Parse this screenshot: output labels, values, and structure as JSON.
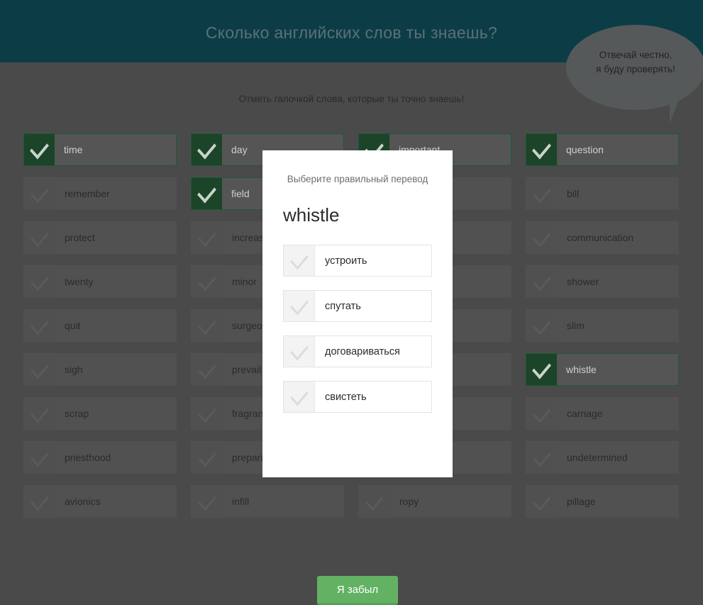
{
  "header": {
    "title": "Сколько английских слов ты знаешь?"
  },
  "bubble": {
    "line1": "Отвечай честно,",
    "line2": "я буду проверять!"
  },
  "subtitle": "Отметь галочкой слова, которые ты точно знаешь!",
  "colors": {
    "header_bg": "#0c3d47",
    "page_bg": "#4a4a4a",
    "checked_green": "#1b4428",
    "checked_border": "#1d5937",
    "button_green": "#63b263",
    "modal_bg": "#ffffff"
  },
  "columns": [
    {
      "words": [
        {
          "text": "time",
          "checked": true
        },
        {
          "text": "remember",
          "checked": false
        },
        {
          "text": "protect",
          "checked": false
        },
        {
          "text": "twenty",
          "checked": false
        },
        {
          "text": "quit",
          "checked": false
        },
        {
          "text": "sigh",
          "checked": false
        },
        {
          "text": "scrap",
          "checked": false
        },
        {
          "text": "priesthood",
          "checked": false
        },
        {
          "text": "avionics",
          "checked": false
        }
      ]
    },
    {
      "words": [
        {
          "text": "day",
          "checked": true
        },
        {
          "text": "field",
          "checked": true
        },
        {
          "text": "increase",
          "checked": false
        },
        {
          "text": "minor",
          "checked": false
        },
        {
          "text": "surgeon",
          "checked": false
        },
        {
          "text": "prevail",
          "checked": false
        },
        {
          "text": "fragrance",
          "checked": false
        },
        {
          "text": "preparing",
          "checked": false
        },
        {
          "text": "infill",
          "checked": false
        }
      ]
    },
    {
      "words": [
        {
          "text": "important",
          "checked": true
        },
        {
          "text": "",
          "checked": false
        },
        {
          "text": "",
          "checked": false
        },
        {
          "text": "",
          "checked": false
        },
        {
          "text": "",
          "checked": false
        },
        {
          "text": "",
          "checked": false
        },
        {
          "text": "",
          "checked": false
        },
        {
          "text": "",
          "checked": false
        },
        {
          "text": "ropy",
          "checked": false
        }
      ]
    },
    {
      "words": [
        {
          "text": "question",
          "checked": true
        },
        {
          "text": "bill",
          "checked": false
        },
        {
          "text": "communication",
          "checked": false
        },
        {
          "text": "shower",
          "checked": false
        },
        {
          "text": "slim",
          "checked": false
        },
        {
          "text": "whistle",
          "checked": true
        },
        {
          "text": "carnage",
          "checked": false
        },
        {
          "text": "undetermined",
          "checked": false
        },
        {
          "text": "pillage",
          "checked": false
        }
      ]
    }
  ],
  "modal": {
    "prompt": "Выберите правильный перевод",
    "word": "whistle",
    "options": [
      {
        "text": "устроить"
      },
      {
        "text": "спутать"
      },
      {
        "text": "договариваться"
      },
      {
        "text": "свистеть"
      }
    ],
    "forgot_label": "Я забыл"
  }
}
